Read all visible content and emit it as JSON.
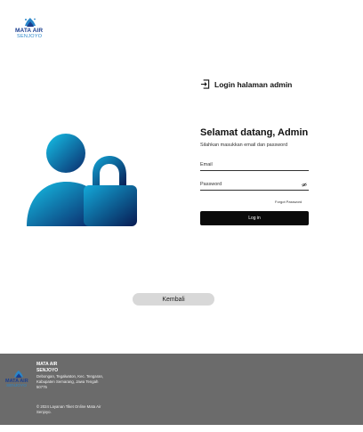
{
  "brand": {
    "name_line1": "MATA AIR",
    "name_line2": "SENJOYO",
    "logo_text_1": "MATA AIR",
    "logo_text_2": "SENJOYO"
  },
  "login": {
    "header": "Login halaman admin",
    "welcome": "Selamat datang, Admin",
    "subtitle": "Silahkan masukkan email dan password",
    "email_label": "Email",
    "password_label": "Password",
    "forgot_label": "Forgot Password",
    "submit_label": "Log in"
  },
  "back_label": "Kembali",
  "footer": {
    "name_line1": "MATA AIR",
    "name_line2": "SENJOYO",
    "address": "Debongan, Tegalwaton, Kec. Tengaran, Kabupaten Semarang, Jawa Tengah 50775",
    "copyright": "© 2024 Layanan Tiket Online Mata Air Senjoyo."
  },
  "icons": {
    "login_icon": "login-arrow-icon",
    "eye_icon": "eye-off-icon",
    "hero_icon": "user-lock-icon"
  },
  "colors": {
    "gradient_start": "#12b8e0",
    "gradient_end": "#0a1f5c",
    "button": "#0a0a0a",
    "footer": "#6b6b6b",
    "back_button": "#d8d8d8"
  }
}
